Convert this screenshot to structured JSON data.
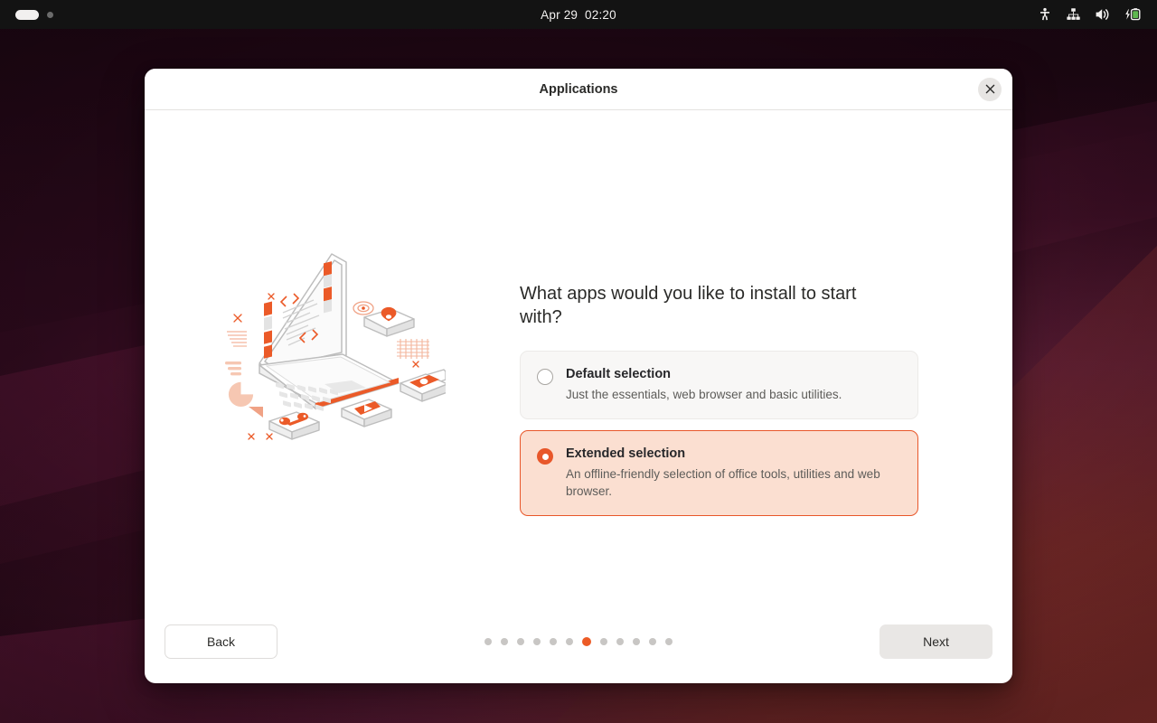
{
  "topbar": {
    "clock": "Apr 29  02:20",
    "workspace_indicator": "workspace-pill",
    "icons": [
      {
        "name": "accessibility-icon",
        "label": "Accessibility"
      },
      {
        "name": "network-wired-icon",
        "label": "Network"
      },
      {
        "name": "volume-icon",
        "label": "Volume"
      },
      {
        "name": "battery-charging-icon",
        "label": "Battery charging"
      }
    ]
  },
  "dialog": {
    "title": "Applications",
    "close_label": "×",
    "heading": "What apps would you like to install to start with?",
    "illustration": "laptop-apps-illustration",
    "options": [
      {
        "id": "default-selection",
        "title": "Default selection",
        "description": "Just the essentials, web browser and basic utilities.",
        "selected": false
      },
      {
        "id": "extended-selection",
        "title": "Extended selection",
        "description": "An offline-friendly selection of office tools, utilities and web browser.",
        "selected": true
      }
    ],
    "footer": {
      "back_label": "Back",
      "next_label": "Next",
      "progress_total": 12,
      "progress_current": 7
    }
  },
  "colors": {
    "accent_orange": "#e8572a",
    "dot_active": "#ec5b26",
    "card_selected_bg": "#fbdfd1",
    "card_plain_bg": "#f8f7f6",
    "topbar_bg": "#131313",
    "battery_green": "#5fb84f",
    "wallpaper_dark": "#2a0817",
    "wallpaper_light": "#a63b34"
  }
}
